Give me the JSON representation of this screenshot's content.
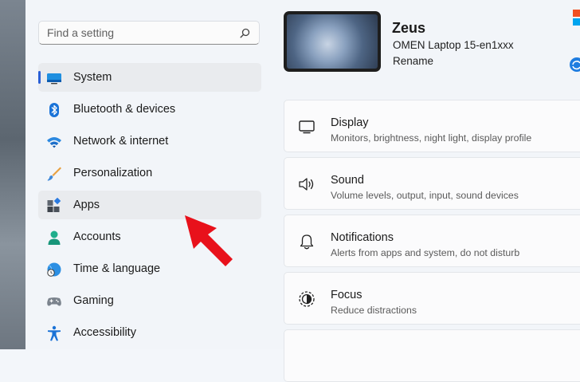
{
  "search": {
    "placeholder": "Find a setting"
  },
  "nav": {
    "items": [
      {
        "label": "System"
      },
      {
        "label": "Bluetooth & devices"
      },
      {
        "label": "Network & internet"
      },
      {
        "label": "Personalization"
      },
      {
        "label": "Apps"
      },
      {
        "label": "Accounts"
      },
      {
        "label": "Time & language"
      },
      {
        "label": "Gaming"
      },
      {
        "label": "Accessibility"
      }
    ],
    "selected": "System",
    "highlighted": "Apps"
  },
  "device": {
    "name": "Zeus",
    "model": "OMEN Laptop 15-en1xxx",
    "rename_label": "Rename"
  },
  "cards": [
    {
      "title": "Display",
      "subtitle": "Monitors, brightness, night light, display profile",
      "icon": "display-icon"
    },
    {
      "title": "Sound",
      "subtitle": "Volume levels, output, input, sound devices",
      "icon": "speaker-icon"
    },
    {
      "title": "Notifications",
      "subtitle": "Alerts from apps and system, do not disturb",
      "icon": "bell-icon"
    },
    {
      "title": "Focus",
      "subtitle": "Reduce distractions",
      "icon": "focus-icon"
    }
  ],
  "colors": {
    "accent": "#2a5fd6",
    "annotation_arrow": "#e8111b"
  }
}
